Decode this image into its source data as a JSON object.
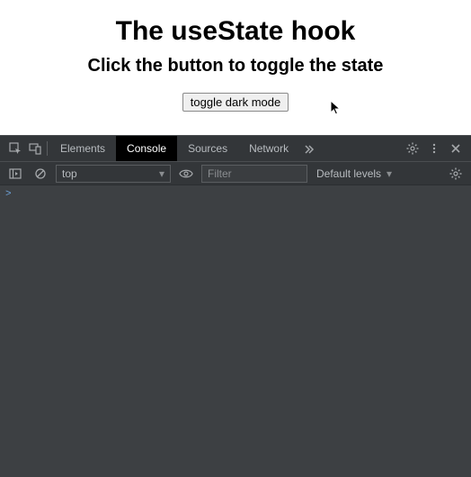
{
  "app": {
    "title": "The useState hook",
    "subtitle": "Click the button to toggle the state",
    "button_label": "toggle dark mode"
  },
  "devtools": {
    "tabs": {
      "elements": "Elements",
      "console": "Console",
      "sources": "Sources",
      "network": "Network"
    },
    "toolbar": {
      "context_value": "top",
      "filter_placeholder": "Filter",
      "levels_label": "Default levels"
    },
    "prompt": ">"
  }
}
